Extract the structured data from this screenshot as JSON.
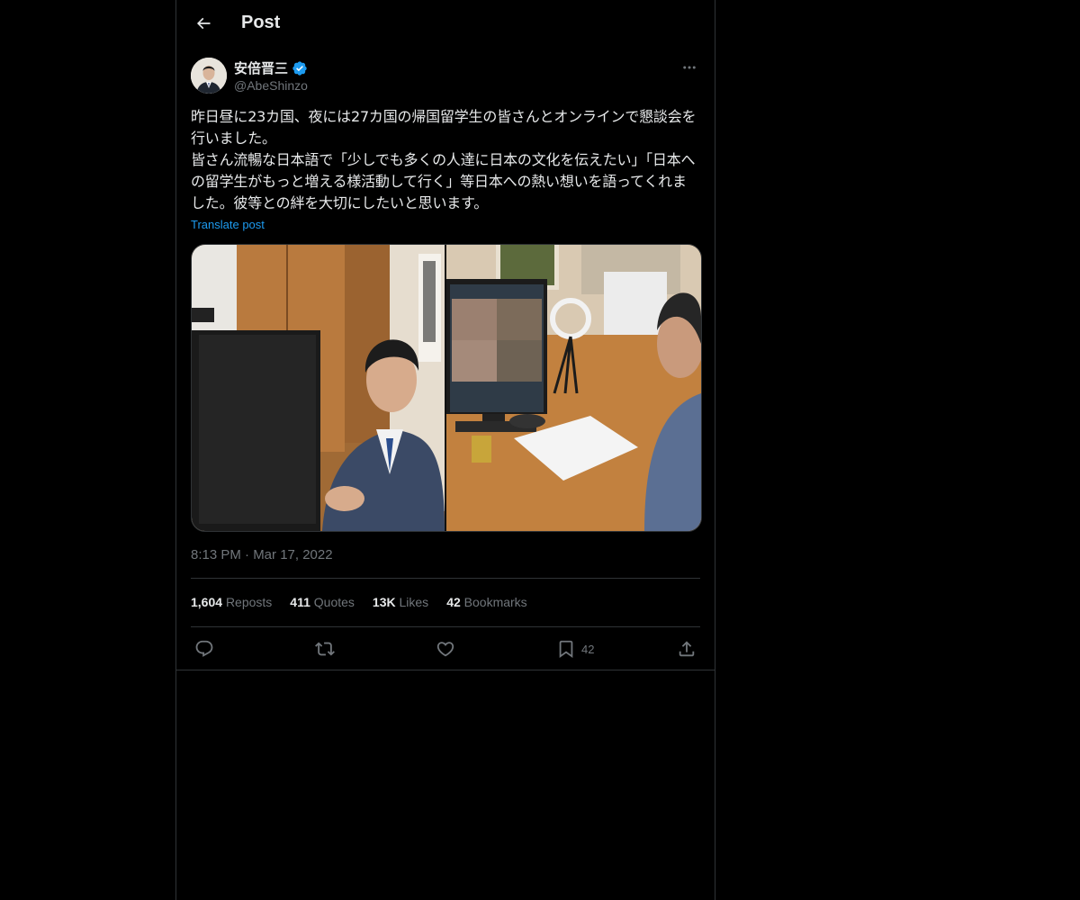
{
  "header": {
    "title": "Post",
    "back_icon": "arrow-left-icon"
  },
  "post": {
    "author": {
      "display_name": "安倍晋三",
      "handle": "@AbeShinzo",
      "verified": true,
      "verified_color": "#1d9bf0"
    },
    "text": "昨日昼に23カ国、夜には27カ国の帰国留学生の皆さんとオンラインで懇談会を行いました。\n皆さん流暢な日本語で「少しでも多くの人達に日本の文化を伝えたい」「日本への留学生がもっと増える様活動して行く」等日本への熱い想いを語ってくれました。彼等との絆を大切にしたいと思います。",
    "translate_label": "Translate post",
    "timestamp": "8:13 PM · Mar 17, 2022",
    "stats": [
      {
        "count": "1,604",
        "label": "Reposts"
      },
      {
        "count": "411",
        "label": "Quotes"
      },
      {
        "count": "13K",
        "label": "Likes"
      },
      {
        "count": "42",
        "label": "Bookmarks"
      }
    ],
    "actions": {
      "reply_icon": "reply-icon",
      "repost_icon": "repost-icon",
      "like_icon": "heart-icon",
      "bookmark_icon": "bookmark-icon",
      "bookmark_count": "42",
      "share_icon": "share-icon"
    }
  },
  "colors": {
    "background": "#000000",
    "text": "#e7e9ea",
    "muted": "#71767b",
    "link": "#1d9bf0",
    "border": "#2f3336"
  }
}
